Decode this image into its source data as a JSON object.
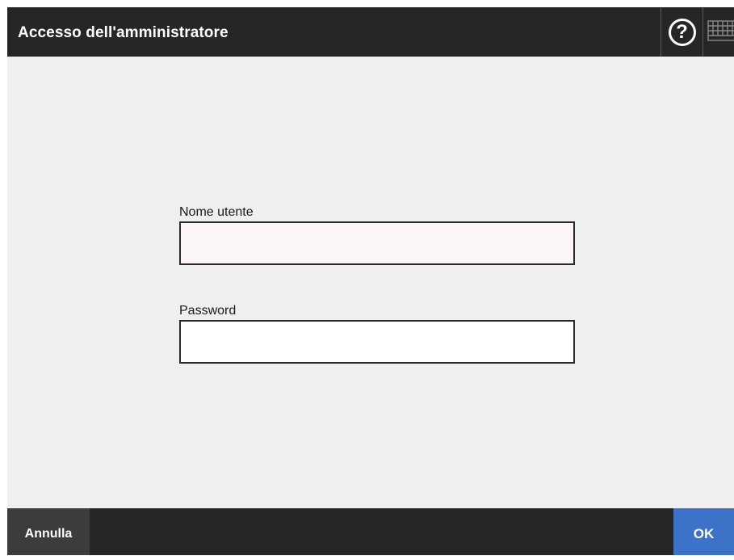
{
  "header": {
    "title": "Accesso dell'amministratore",
    "help_glyph": "?",
    "help_icon": "help-icon",
    "keyboard_icon": "keyboard-icon"
  },
  "form": {
    "username": {
      "label": "Nome utente",
      "value": ""
    },
    "password": {
      "label": "Password",
      "value": ""
    }
  },
  "footer": {
    "cancel_label": "Annulla",
    "ok_label": "OK"
  },
  "colors": {
    "bar": "#262626",
    "background": "#efefef",
    "cancel": "#3c3c3c",
    "ok": "#3d72c9"
  }
}
